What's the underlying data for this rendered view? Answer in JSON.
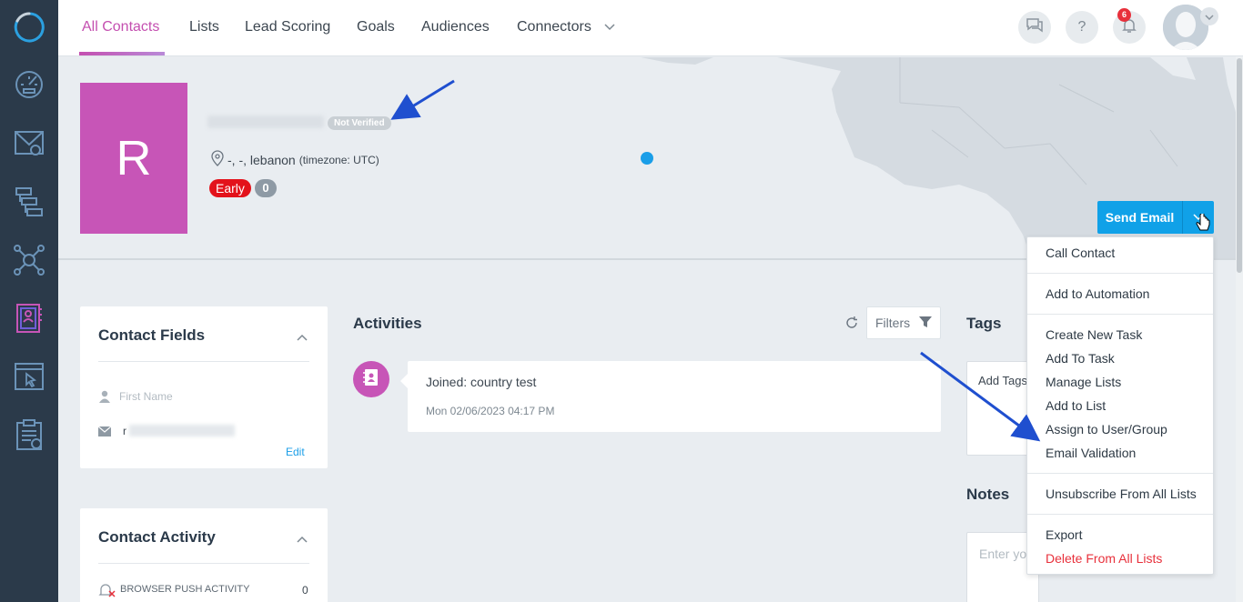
{
  "colors": {
    "sidebar_bg": "#2b3a4a",
    "accent_pink": "#c44fb0",
    "send_blue": "#10a1e8",
    "danger_red": "#e8303b",
    "annotation_arrow": "#1f4fcf"
  },
  "sidebar": {
    "items": [
      {
        "icon": "app-logo-icon"
      },
      {
        "icon": "dashboard-gauge-icon"
      },
      {
        "icon": "email-campaign-icon"
      },
      {
        "icon": "automation-flow-icon"
      },
      {
        "icon": "network-hub-icon"
      },
      {
        "icon": "contacts-icon",
        "active": true
      },
      {
        "icon": "landing-page-icon"
      },
      {
        "icon": "forms-clipboard-icon"
      }
    ]
  },
  "topnav": {
    "tabs": [
      {
        "label": "All Contacts",
        "active": true
      },
      {
        "label": "Lists"
      },
      {
        "label": "Lead Scoring"
      },
      {
        "label": "Goals"
      },
      {
        "label": "Audiences"
      },
      {
        "label": "Connectors",
        "has_dropdown": true
      }
    ],
    "help_label": "?",
    "notifications_count": "6",
    "icons": [
      "chat-bubbles-icon",
      "help-icon",
      "bell-icon",
      "user-avatar-icon",
      "chevron-down-icon"
    ]
  },
  "contact": {
    "initial": "R",
    "verification_status": "Not Verified",
    "location": "-, -, lebanon",
    "timezone": "(timezone: UTC)",
    "stage": "Early",
    "score": "0"
  },
  "actions": {
    "send_email": "Send Email",
    "dropdown": [
      {
        "label": "Call Contact",
        "group": 1
      },
      {
        "label": "Add to Automation",
        "group": 2
      },
      {
        "label": "Create New Task",
        "group": 3
      },
      {
        "label": "Add To Task",
        "group": 3
      },
      {
        "label": "Manage Lists",
        "group": 3
      },
      {
        "label": "Add to List",
        "group": 3
      },
      {
        "label": "Assign to User/Group",
        "group": 3
      },
      {
        "label": "Email Validation",
        "group": 3
      },
      {
        "label": "Unsubscribe From All Lists",
        "group": 4
      },
      {
        "label": "Export",
        "group": 5
      },
      {
        "label": "Delete From All Lists",
        "group": 5,
        "danger": true
      }
    ]
  },
  "contact_fields": {
    "title": "Contact Fields",
    "first_name_placeholder": "First Name",
    "email_prefix": "r",
    "edit_label": "Edit"
  },
  "contact_activity": {
    "title": "Contact Activity",
    "rows": [
      {
        "label": "BROWSER PUSH ACTIVITY",
        "count": "0"
      }
    ]
  },
  "activities": {
    "title": "Activities",
    "filters_label": "Filters",
    "items": [
      {
        "text": "Joined: country test",
        "timestamp": "Mon 02/06/2023 04:17 PM"
      }
    ]
  },
  "tags": {
    "title": "Tags",
    "placeholder": "Add Tags"
  },
  "notes": {
    "title": "Notes",
    "placeholder": "Enter yo"
  }
}
